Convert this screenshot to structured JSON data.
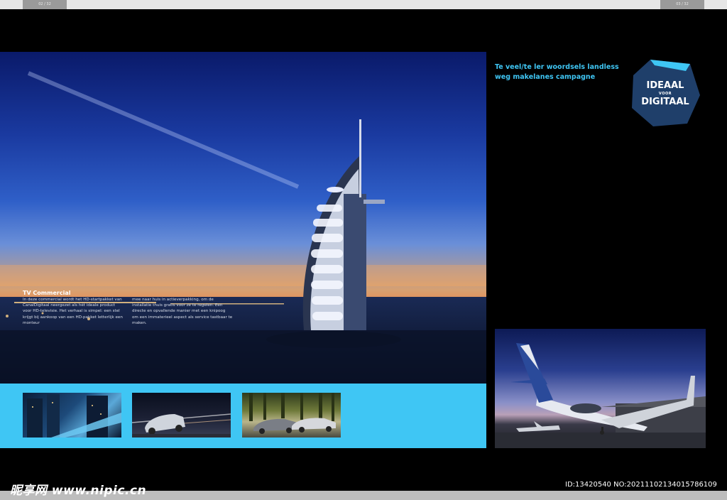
{
  "pages": {
    "left_tab": "02 / 32",
    "right_tab": "03 / 32"
  },
  "left_spread": {
    "caption": {
      "title": "TV Commercial",
      "col1": "In deze commercial wordt het HD-startpakket van CanalDigitaal neergezet als hét ideale product voor HD-televisie. Het verhaal is simpel: een stel krijgt bij aankoop van een HD-pakket letterlijk een monteur",
      "col2": "mee naar huis in actieverpakking, om de installatie thuis gratis voor ze te regelen. Een directe en opvallende manier met een knipoog om een immaterieel aspect als service tastbaar te maken."
    },
    "thumbnails": [
      "city-night-thumbnail",
      "car-night-thumbnail",
      "car-forest-thumbnail"
    ]
  },
  "right_page": {
    "headline": "Te veel/te ler woordsels landless weg makelanes campagne",
    "logo": {
      "line1": "IDEAAL",
      "line2": "VOOR",
      "line3": "DIGITAAL",
      "color": "#1f3f6a",
      "accent": "#3fc6f4"
    }
  },
  "watermark": {
    "left": "昵享网 www.nipic.cn",
    "right": "ID:13420540 NO:20211102134015786109"
  },
  "colors": {
    "accent_blue": "#3fc6f4",
    "background": "#000000"
  }
}
